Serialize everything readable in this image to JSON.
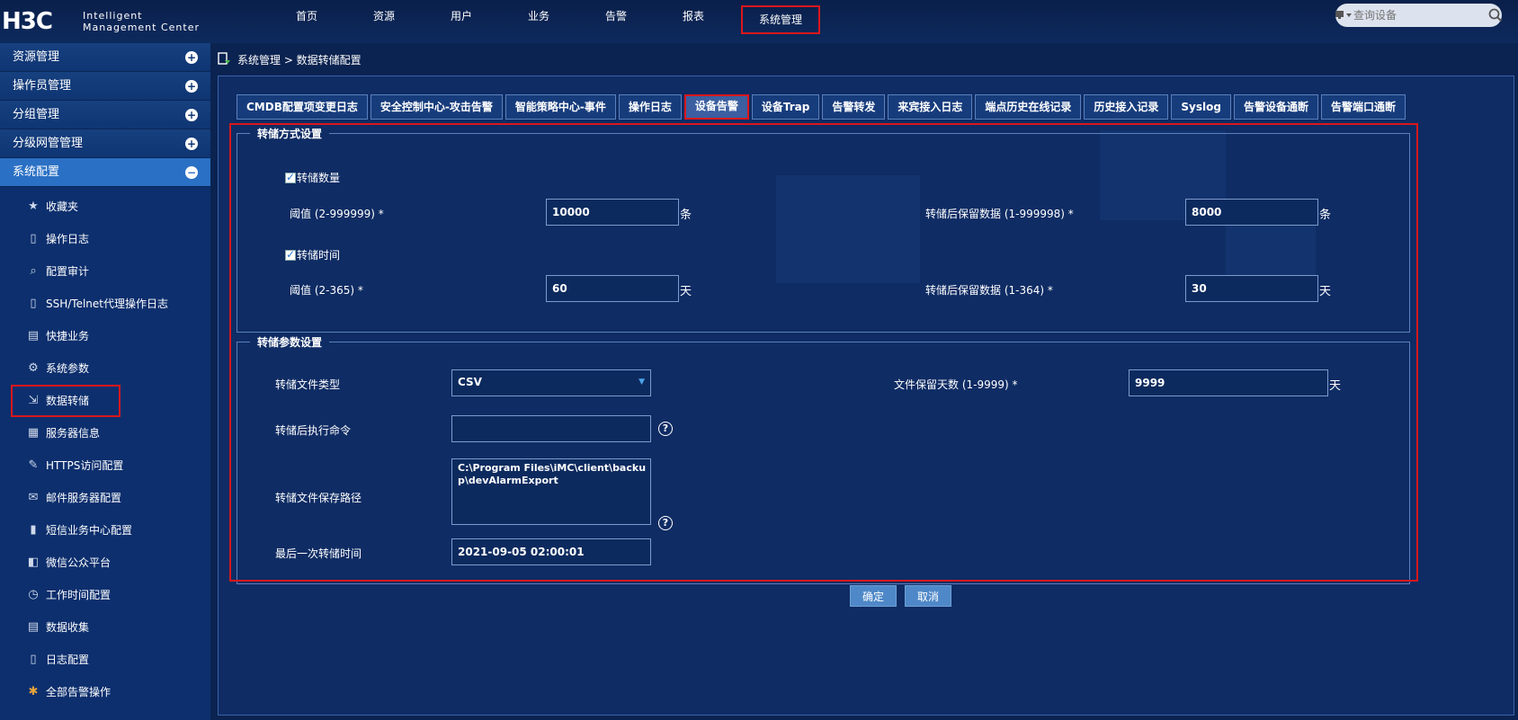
{
  "header": {
    "logo_mark": "H3C",
    "logo_line1": "Intelligent",
    "logo_line2": "Management Center",
    "nav": [
      "首页",
      "资源",
      "用户",
      "业务",
      "告警",
      "报表",
      "系统管理"
    ],
    "active_nav": "系统管理",
    "search_placeholder": "查询设备"
  },
  "sidebar": {
    "groups": [
      "资源管理",
      "操作员管理",
      "分组管理",
      "分级网管管理",
      "系统配置"
    ],
    "open_group": "系统配置",
    "items": [
      {
        "label": "收藏夹",
        "icon": "star-icon"
      },
      {
        "label": "操作日志",
        "icon": "clipboard-icon"
      },
      {
        "label": "配置审计",
        "icon": "magnifier-icon"
      },
      {
        "label": "SSH/Telnet代理操作日志",
        "icon": "clipboard-icon"
      },
      {
        "label": "快捷业务",
        "icon": "card-icon"
      },
      {
        "label": "系统参数",
        "icon": "gear-icon"
      },
      {
        "label": "数据转储",
        "icon": "dump-icon"
      },
      {
        "label": "服务器信息",
        "icon": "server-icon"
      },
      {
        "label": "HTTPS访问配置",
        "icon": "edit-icon"
      },
      {
        "label": "邮件服务器配置",
        "icon": "mail-server-icon"
      },
      {
        "label": "短信业务中心配置",
        "icon": "phone-icon"
      },
      {
        "label": "微信公众平台",
        "icon": "wechat-icon"
      },
      {
        "label": "工作时间配置",
        "icon": "clock-gear-icon"
      },
      {
        "label": "数据收集",
        "icon": "document-icon"
      },
      {
        "label": "日志配置",
        "icon": "log-icon"
      },
      {
        "label": "全部告警操作",
        "icon": "alarm-icon"
      }
    ],
    "highlighted_item": "数据转储"
  },
  "breadcrumb": "系统管理 > 数据转储配置",
  "tabs": [
    "CMDB配置项变更日志",
    "安全控制中心-攻击告警",
    "智能策略中心-事件",
    "操作日志",
    "设备告警",
    "设备Trap",
    "告警转发",
    "来宾接入日志",
    "端点历史在线记录",
    "历史接入记录",
    "Syslog",
    "告警设备通断",
    "告警端口通断"
  ],
  "active_tab": "设备告警",
  "dump_mode": {
    "legend": "转储方式设置",
    "count_checkbox": "转储数量",
    "count_threshold_label": "阈值 (2-999999)",
    "count_threshold_value": "10000",
    "count_unit": "条",
    "count_keep_label": "转储后保留数据 (1-999998)",
    "count_keep_value": "8000",
    "count_keep_unit": "条",
    "time_checkbox": "转储时间",
    "time_threshold_label": "阈值 (2-365)",
    "time_threshold_value": "60",
    "time_unit": "天",
    "time_keep_label": "转储后保留数据 (1-364)",
    "time_keep_value": "30",
    "time_keep_unit": "天",
    "required_mark": "*"
  },
  "dump_params": {
    "legend": "转储参数设置",
    "file_type_label": "转储文件类型",
    "file_type_value": "CSV",
    "keep_days_label": "文件保留天数 (1-9999)",
    "keep_days_value": "9999",
    "keep_days_unit": "天",
    "post_cmd_label": "转储后执行命令",
    "post_cmd_value": "",
    "path_label": "转储文件保存路径",
    "path_value": "C:\\Program Files\\iMC\\client\\backup\\devAlarmExport",
    "last_time_label": "最后一次转储时间",
    "last_time_value": "2021-09-05 02:00:01",
    "help_mark": "?"
  },
  "buttons": {
    "ok": "确定",
    "cancel": "取消"
  }
}
